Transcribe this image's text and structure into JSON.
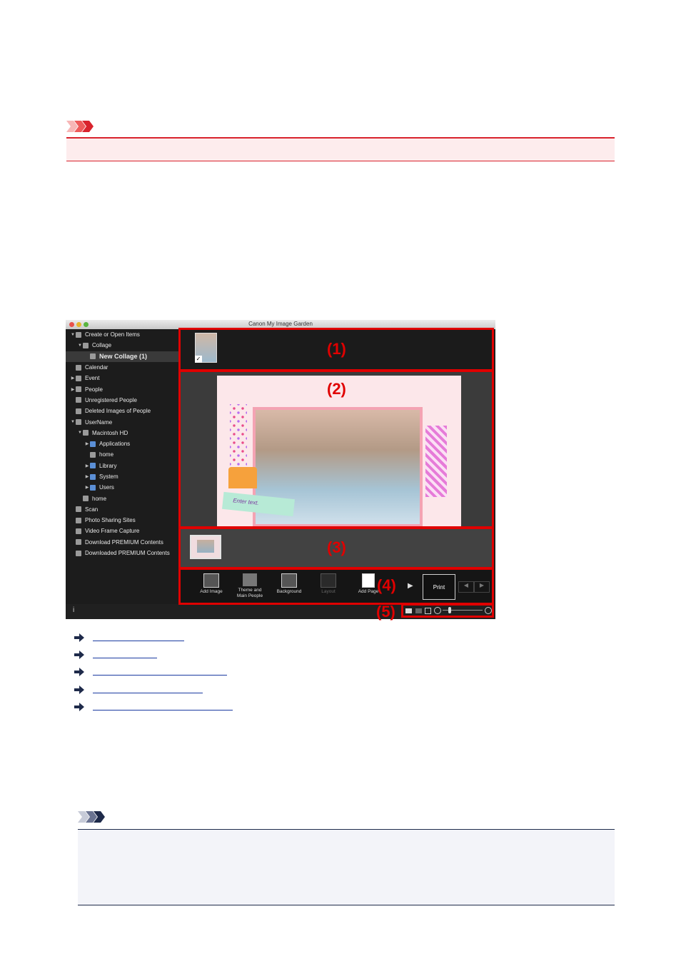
{
  "window": {
    "title": "Canon My Image Garden"
  },
  "sidebar": {
    "items": [
      {
        "label": "Create or Open Items",
        "indent": 0,
        "arrow": "▼",
        "selected": false
      },
      {
        "label": "Collage",
        "indent": 1,
        "arrow": "▼",
        "selected": false
      },
      {
        "label": "New Collage (1)",
        "indent": 2,
        "arrow": "",
        "selected": true
      },
      {
        "label": "Calendar",
        "indent": 0,
        "arrow": "",
        "selected": false
      },
      {
        "label": "Event",
        "indent": 0,
        "arrow": "▶",
        "selected": false
      },
      {
        "label": "People",
        "indent": 0,
        "arrow": "▶",
        "selected": false
      },
      {
        "label": "Unregistered People",
        "indent": 0,
        "arrow": "",
        "selected": false
      },
      {
        "label": "Deleted Images of People",
        "indent": 0,
        "arrow": "",
        "selected": false
      },
      {
        "label": "UserName",
        "indent": 0,
        "arrow": "▼",
        "selected": false
      },
      {
        "label": "Macintosh HD",
        "indent": 1,
        "arrow": "▼",
        "selected": false
      },
      {
        "label": "Applications",
        "indent": 2,
        "arrow": "▶",
        "selected": false,
        "folder": true
      },
      {
        "label": "home",
        "indent": 2,
        "arrow": "",
        "selected": false
      },
      {
        "label": "Library",
        "indent": 2,
        "arrow": "▶",
        "selected": false,
        "folder": true
      },
      {
        "label": "System",
        "indent": 2,
        "arrow": "▶",
        "selected": false,
        "folder": true
      },
      {
        "label": "Users",
        "indent": 2,
        "arrow": "▶",
        "selected": false,
        "folder": true
      },
      {
        "label": "home",
        "indent": 1,
        "arrow": "",
        "selected": false
      },
      {
        "label": "Scan",
        "indent": 0,
        "arrow": "",
        "selected": false
      },
      {
        "label": "Photo Sharing Sites",
        "indent": 0,
        "arrow": "",
        "selected": false
      },
      {
        "label": "Video Frame Capture",
        "indent": 0,
        "arrow": "",
        "selected": false
      },
      {
        "label": "Download PREMIUM Contents",
        "indent": 0,
        "arrow": "",
        "selected": false
      },
      {
        "label": "Downloaded PREMIUM Contents",
        "indent": 0,
        "arrow": "",
        "selected": false
      }
    ]
  },
  "canvas": {
    "text_placeholder": "Enter text."
  },
  "toolbar": {
    "add_image": "Add Image",
    "theme_line1": "Theme and",
    "theme_line2": "Main People",
    "background": "Background",
    "layout": "Layout",
    "add_page": "Add Page",
    "print": "Print"
  },
  "statusbar": {
    "info": "i"
  },
  "callouts": [
    "(1)",
    "(2)",
    "(3)",
    "(4)",
    "(5)"
  ],
  "colors": {
    "important": "#d9232d",
    "note": "#1e2a4a",
    "callout": "#e00000",
    "link": "#1a3aa0"
  }
}
